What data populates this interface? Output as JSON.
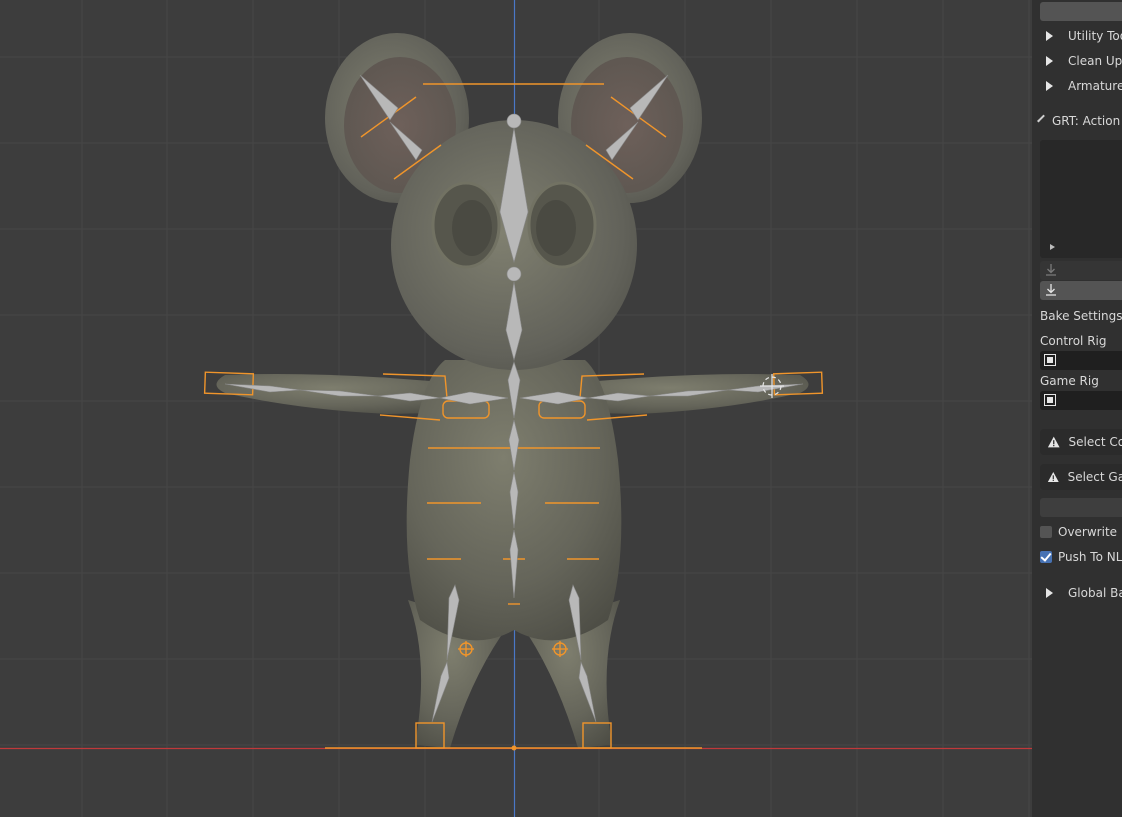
{
  "viewport": {
    "background": "#3d3d3d",
    "grid_color": "#474747",
    "x_axis_color": "#c0393b",
    "z_axis_color": "#4a78c7",
    "bone_color": "#b3b3b3",
    "control_color": "#f0952b",
    "model_color": "#6a6a5c"
  },
  "sidebar": {
    "collapsed_sections": [
      {
        "label": "Utility Tool"
      },
      {
        "label": "Clean Up T"
      },
      {
        "label": "Armature D"
      }
    ],
    "action_panel": {
      "title": "GRT: Action B"
    },
    "bake_settings": {
      "heading": "Bake Settings",
      "control_rig_label": "Control Rig",
      "game_rig_label": "Game Rig"
    },
    "warnings": [
      {
        "label": "Select Cor"
      },
      {
        "label": "Select Gar"
      }
    ],
    "options": {
      "overwrite_label": "Overwrite",
      "overwrite_checked": false,
      "push_to_nla_label": "Push To NLA",
      "push_to_nla_checked": true
    },
    "global_section": {
      "label": "Global Bak"
    }
  }
}
